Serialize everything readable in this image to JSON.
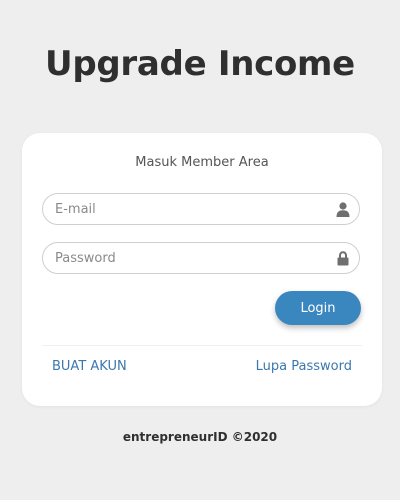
{
  "app": {
    "title": "Upgrade Income"
  },
  "login": {
    "heading": "Masuk Member Area",
    "email_placeholder": "E-mail",
    "email_value": "",
    "password_placeholder": "Password",
    "password_value": "",
    "email_icon": "user-icon",
    "password_icon": "lock-icon",
    "submit_label": "Login",
    "create_account_label": "BUAT AKUN",
    "forgot_password_label": "Lupa Password"
  },
  "footer": {
    "text": "entrepreneurID ©2020"
  },
  "colors": {
    "background": "#eeeeee",
    "accent": "#3a87bf",
    "link": "#3a78b0"
  }
}
